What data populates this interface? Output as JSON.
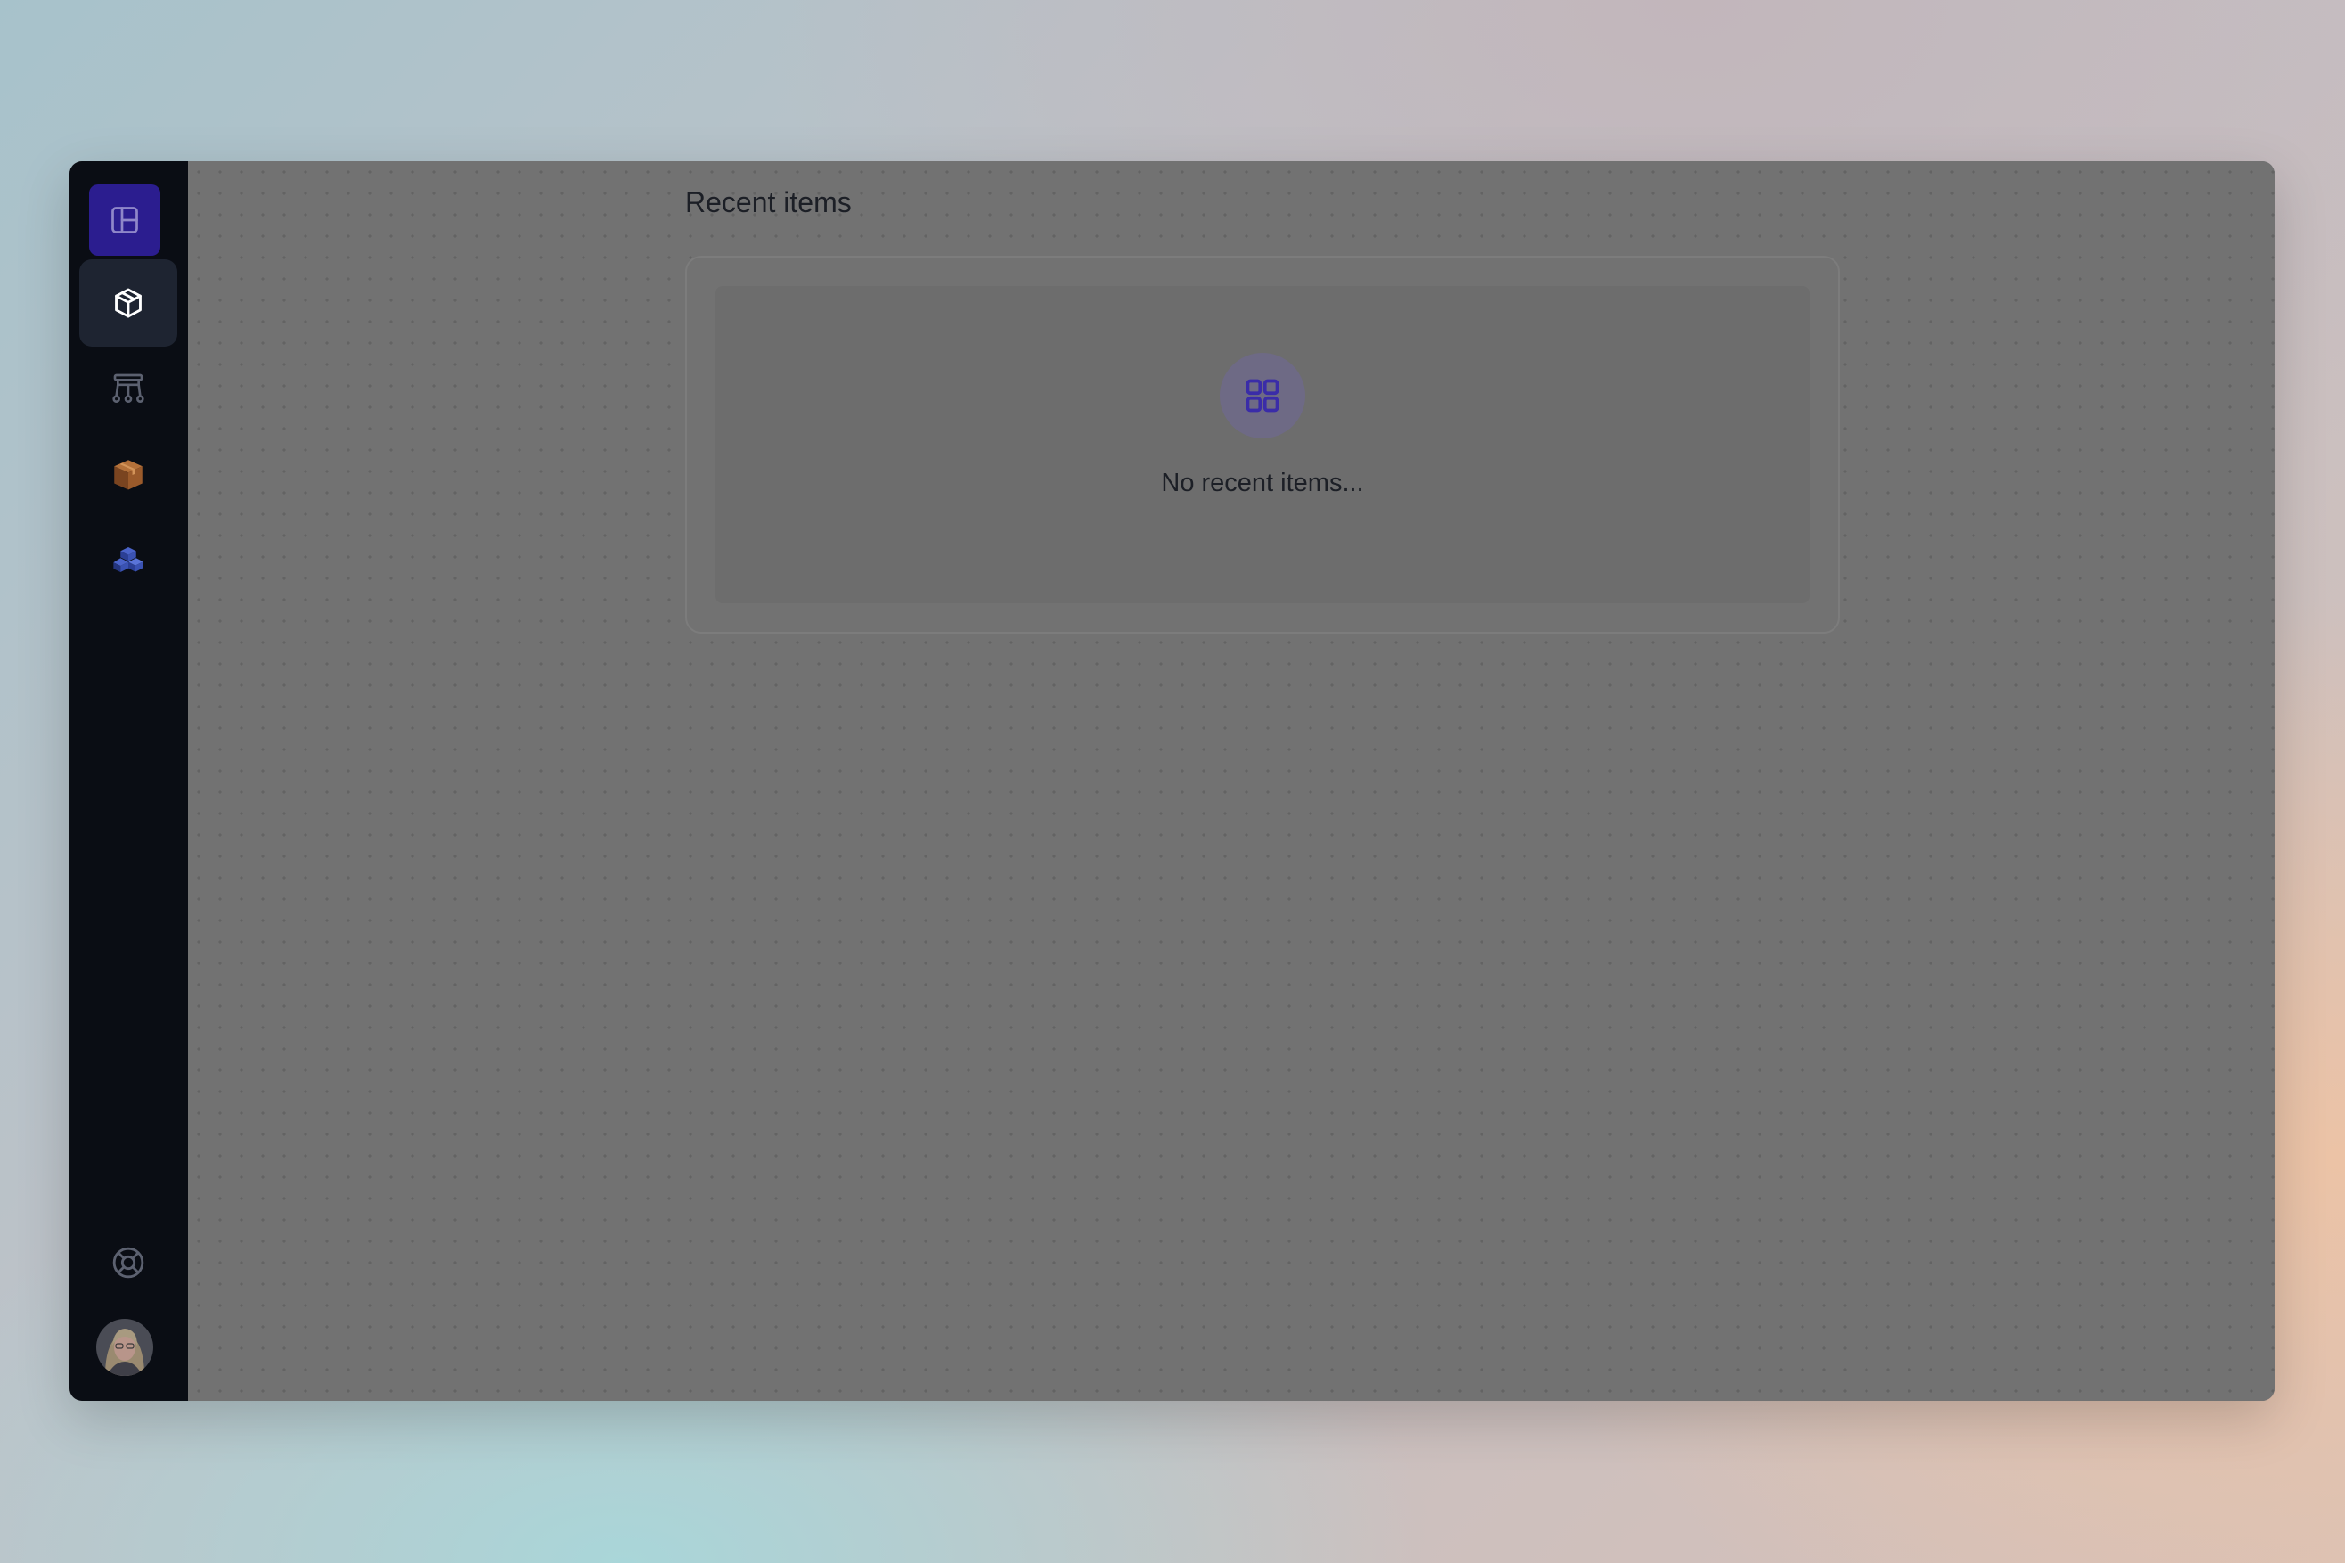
{
  "sidebar": {
    "items": [
      {
        "icon": "layout-panel-icon"
      },
      {
        "icon": "cube-icon",
        "active": true
      },
      {
        "icon": "hierarchy-icon"
      },
      {
        "icon": "orange-package-icon"
      },
      {
        "icon": "blue-blocks-icon"
      }
    ],
    "bottom": [
      {
        "icon": "lifebuoy-icon"
      },
      {
        "icon": "user-avatar"
      }
    ]
  },
  "main": {
    "title": "Recent items",
    "empty_state": {
      "icon": "grid-icon",
      "message": "No recent items..."
    }
  },
  "colors": {
    "sidebar_bg": "#0a0d14",
    "logo_bg": "#2b1d8f",
    "active_item_bg": "#1e2431",
    "accent": "#3a2ca8",
    "overlay": "#727272"
  }
}
